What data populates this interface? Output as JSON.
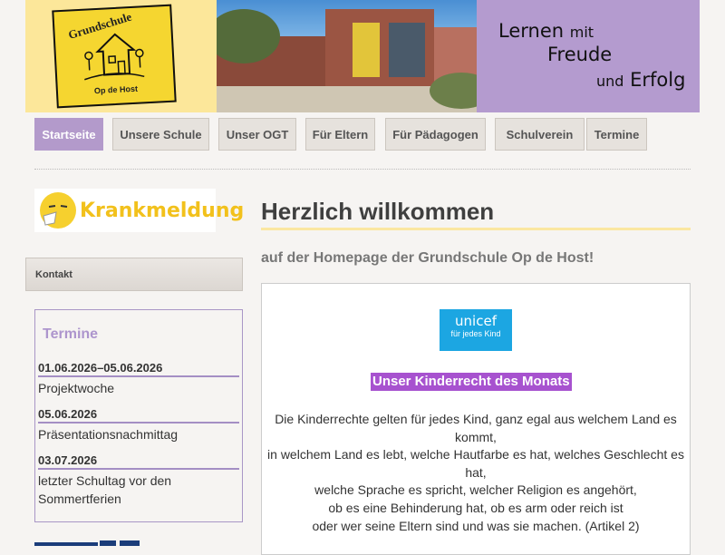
{
  "banner": {
    "logo_name": "Grundschule",
    "logo_sub": "Op de Host",
    "tagline": {
      "line1a": "Lernen",
      "line1b": "mit",
      "line2": "Freude",
      "line3a": "und",
      "line3b": "Erfolg"
    }
  },
  "nav": {
    "items": [
      {
        "label": "Startseite",
        "active": true
      },
      {
        "label": "Unsere Schule",
        "active": false
      },
      {
        "label": "Unser OGT",
        "active": false
      },
      {
        "label": "Für Eltern",
        "active": false
      },
      {
        "label": "Für Pädagogen",
        "active": false
      },
      {
        "label": "Schulverein",
        "active": false
      },
      {
        "label": "Termine",
        "active": false
      }
    ]
  },
  "sidebar": {
    "krank_label": "Krankmeldung",
    "kontakt_label": "Kontakt",
    "termine_title": "Termine",
    "termine": [
      {
        "date": "01.06.2026–05.06.2026",
        "text": "Projektwoche"
      },
      {
        "date": "05.06.2026",
        "text": "Präsentationsnachmittag"
      },
      {
        "date": "03.07.2026",
        "text": "letzter Schultag vor den Sommertferien"
      }
    ]
  },
  "main": {
    "title": "Herzlich willkommen",
    "subtitle": "auf der Homepage der Grundschule Op de Host!",
    "unicef_name": "unicef",
    "unicef_sub": "für jedes Kind",
    "kinderrecht_title": "Unser Kinderrecht des Monats",
    "paragraph_lines": [
      "Die Kinderrechte gelten für jedes Kind, ganz egal aus welchem Land es kommt,",
      "in welchem Land es lebt, welche Hautfarbe es hat, welches Geschlecht es hat,",
      "welche Sprache es spricht, welcher Religion es angehört,",
      "ob es eine Behinderung hat, ob es arm oder reich ist",
      "oder wer seine Eltern sind und was sie machen. (Artikel 2)"
    ]
  },
  "colors": {
    "accent": "#b39acb",
    "yellow": "#fce79a",
    "unicef": "#1ca6e2",
    "highlight": "#a752cf"
  }
}
